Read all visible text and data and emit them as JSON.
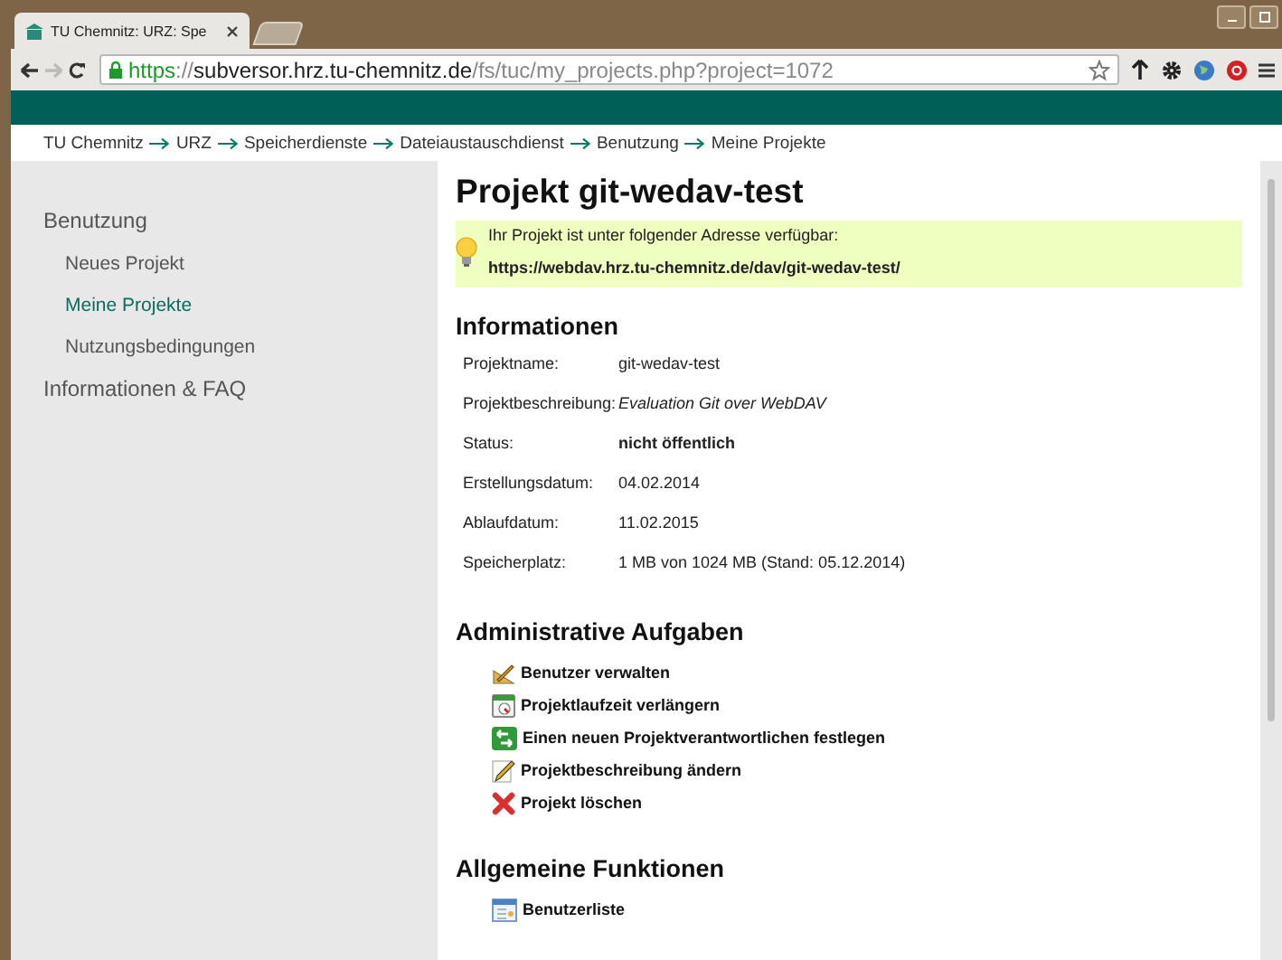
{
  "browser": {
    "tab_title": "TU Chemnitz: URZ: Spe",
    "url": {
      "scheme": "https",
      "separator": "://",
      "host": "subversor.hrz.tu-chemnitz.de",
      "path": "/fs/tuc/my_projects.php?project=1072"
    },
    "forward_disabled": true
  },
  "breadcrumb": [
    "TU Chemnitz",
    "URZ",
    "Speicherdienste",
    "Dateiaustauschdienst",
    "Benutzung",
    "Meine Projekte"
  ],
  "sidebar": {
    "items": [
      {
        "label": "Benutzung",
        "selected": false,
        "children": [
          {
            "label": "Neues Projekt",
            "selected": false
          },
          {
            "label": "Meine Projekte",
            "selected": true
          },
          {
            "label": "Nutzungsbedingungen",
            "selected": false
          }
        ]
      },
      {
        "label": "Informationen & FAQ",
        "selected": false
      }
    ]
  },
  "page": {
    "title": "Projekt git-wedav-test",
    "notice": {
      "text": "Ihr Projekt ist unter folgender Adresse verfügbar:",
      "url": "https://webdav.hrz.tu-chemnitz.de/dav/git-wedav-test/"
    },
    "info": {
      "heading": "Informationen",
      "rows": [
        {
          "label": "Projektname:",
          "value": "git-wedav-test",
          "kind": "plain"
        },
        {
          "label": "Projektbeschreibung:",
          "value": "Evaluation Git over WebDAV",
          "kind": "description"
        },
        {
          "label": "Status:",
          "value": "nicht öffentlich",
          "kind": "status"
        },
        {
          "label": "Erstellungsdatum:",
          "value": "04.02.2014",
          "kind": "plain"
        },
        {
          "label": "Ablaufdatum:",
          "value": "11.02.2015",
          "kind": "plain"
        },
        {
          "label": "Speicherplatz:",
          "value": "1 MB von 1024 MB (Stand: 05.12.2014)",
          "kind": "plain"
        }
      ]
    },
    "sections": [
      {
        "heading": "Administrative Aufgaben",
        "actions": [
          "Benutzer verwalten",
          "Projektlaufzeit verlängern",
          "Einen neuen Projektverantwortlichen festlegen",
          "Projektbeschreibung ändern",
          "Projekt löschen"
        ]
      },
      {
        "heading": "Allgemeine Funktionen",
        "actions": [
          "Benutzerliste"
        ]
      }
    ]
  }
}
